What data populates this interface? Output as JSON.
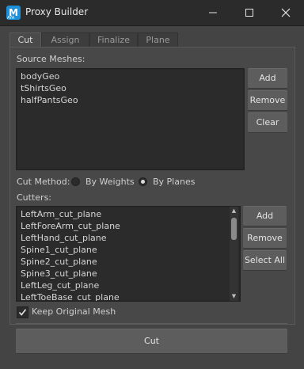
{
  "window": {
    "icon_letter": "M",
    "icon_sub": "AYA",
    "title": "Proxy Builder"
  },
  "tabs": [
    {
      "label": "Cut",
      "active": true
    },
    {
      "label": "Assign",
      "active": false
    },
    {
      "label": "Finalize",
      "active": false
    },
    {
      "label": "Plane",
      "active": false
    }
  ],
  "source": {
    "label": "Source Meshes:",
    "items": [
      "bodyGeo",
      "tShirtsGeo",
      "halfPantsGeo"
    ],
    "add_label": "Add",
    "remove_label": "Remove",
    "clear_label": "Clear"
  },
  "cut_method": {
    "label": "Cut Method:",
    "options": [
      {
        "label": "By Weights",
        "selected": false
      },
      {
        "label": "By Planes",
        "selected": true
      }
    ]
  },
  "cutters": {
    "label": "Cutters:",
    "items": [
      "LeftArm_cut_plane",
      "LeftForeArm_cut_plane",
      "LeftHand_cut_plane",
      "Spine1_cut_plane",
      "Spine2_cut_plane",
      "Spine3_cut_plane",
      "LeftLeg_cut_plane",
      "LeftToeBase_cut_plane"
    ],
    "add_label": "Add",
    "remove_label": "Remove",
    "select_all_label": "Select All"
  },
  "keep_original": {
    "label": "Keep Original Mesh",
    "checked": true
  },
  "cut_button": {
    "label": "Cut"
  }
}
